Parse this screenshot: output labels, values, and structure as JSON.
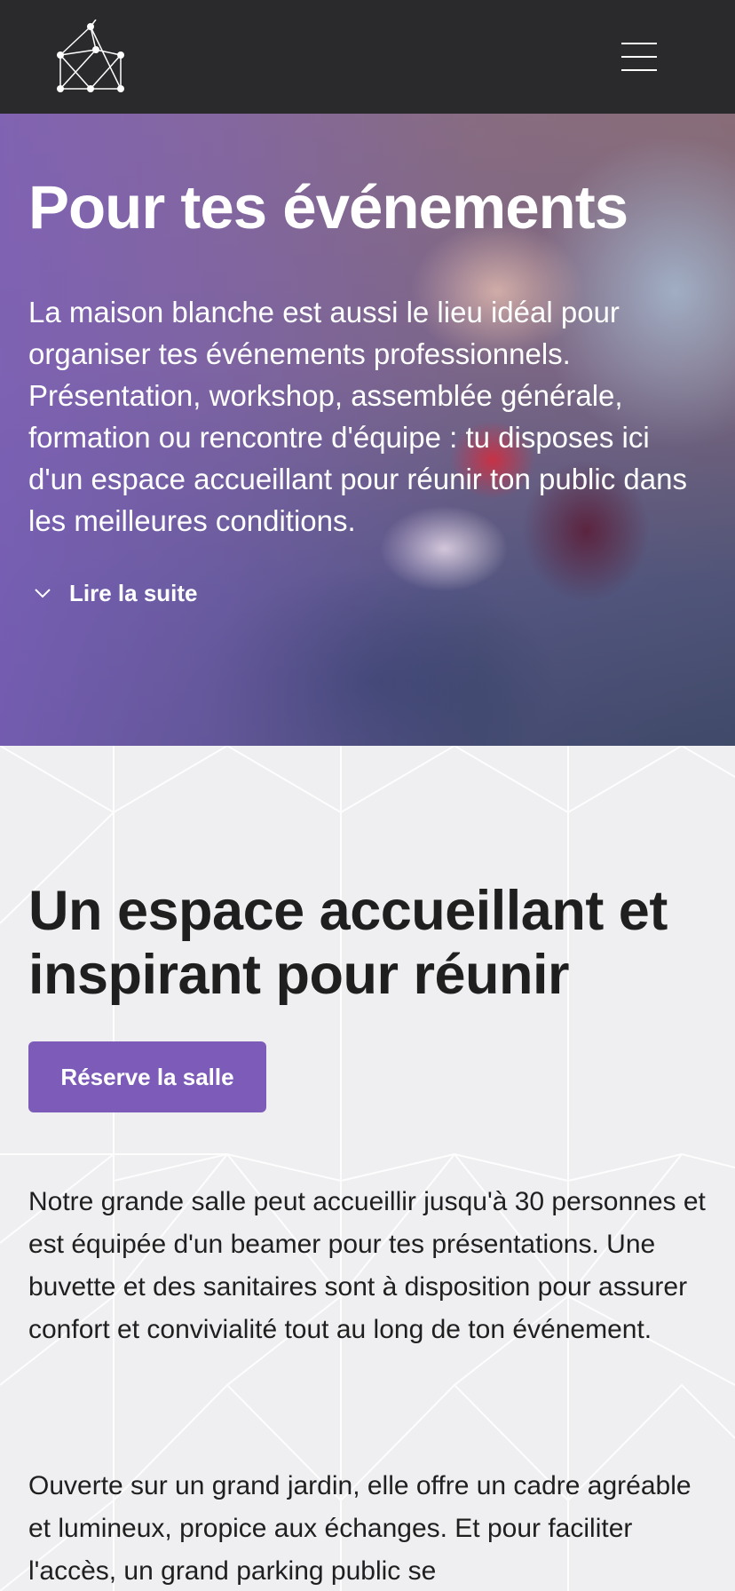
{
  "header": {
    "logo_icon": "constellation-logo-icon",
    "menu_icon": "hamburger-menu-icon"
  },
  "hero": {
    "title": "Pour tes événements",
    "text": "La maison blanche est aussi le lieu idéal pour organiser tes événements professionnels. Présentation, workshop, assemblée générale, formation ou rencontre d'équipe : tu disposes ici d'un espace accueillant pour réunir ton public dans les meilleures conditions.",
    "read_more_label": "Lire la suite",
    "read_more_icon": "chevron-down-icon"
  },
  "section": {
    "title": "Un espace accueillant et inspirant pour réunir",
    "cta_label": "Réserve la salle",
    "paragraphs": [
      "Notre grande salle peut accueillir jusqu'à 30 personnes et est équipée d'un beamer pour tes présentations. Une buvette et des sanitaires sont à disposition pour assurer confort et convivialité tout au long de ton événement.",
      "Ouverte sur un grand jardin, elle offre un cadre agréable et lumineux, propice aux échanges. Et pour faciliter l'accès, un grand parking public se"
    ]
  },
  "colors": {
    "header_bg": "#2a2a2c",
    "accent": "#7c5cb8",
    "page_bg": "#efeff2",
    "text": "#1f1f1f"
  }
}
